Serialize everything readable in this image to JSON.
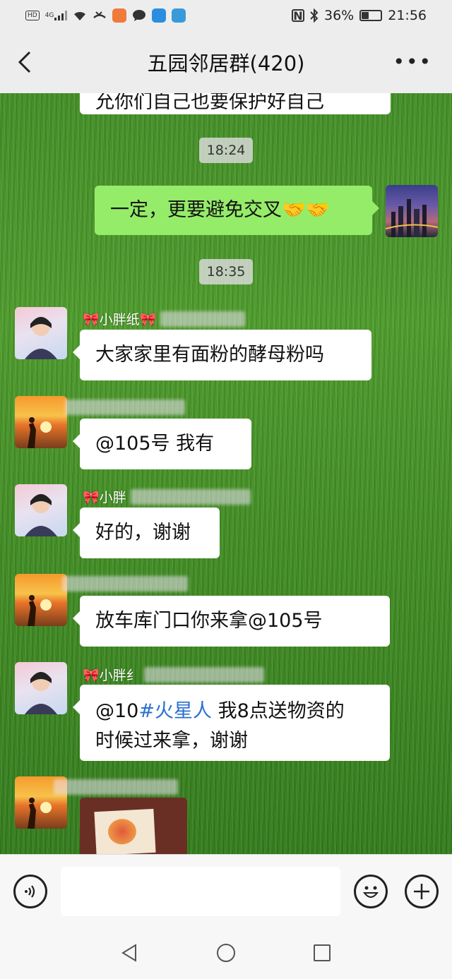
{
  "status_bar": {
    "battery_percent": "36%",
    "battery_level": 0.36,
    "time": "21:56",
    "signal": "4G",
    "hd": "HD"
  },
  "header": {
    "title": "五园邻居群(420)"
  },
  "messages": {
    "top_partial": "允你们自己也要保护好自己",
    "time1": "18:24",
    "my_message": "一定，更要避免交叉🤝🤝",
    "time2": "18:35",
    "nick_a1": "🎀小胖纸🎀",
    "msg_a1": "大家家里有面粉的酵母粉吗",
    "msg_b1": "@105号  我有",
    "nick_a2": "🎀小胖",
    "msg_a2": "好的，谢谢",
    "msg_b2": "放车库门口你来拿@105号",
    "nick_a3": "🎀小胖纟",
    "msg_a3_prefix": "@10",
    "msg_a3_mention": "#火星人",
    "msg_a3_line1_rest": "  我8点送物资的",
    "msg_a3_line2": "时候过来拿，谢谢"
  },
  "icons": {
    "back": "back-arrow-icon",
    "more": "more-dots-icon",
    "voice": "voice-icon",
    "emoji": "emoji-icon",
    "plus": "plus-icon"
  },
  "colors": {
    "my_bubble": "#95ec69",
    "other_bubble": "#ffffff",
    "mention": "#2a6fcf"
  }
}
